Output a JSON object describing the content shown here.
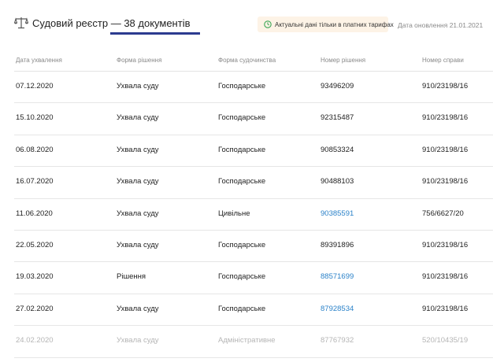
{
  "header": {
    "title": "Судовий реєстр — 38 документів",
    "notice": "Актуальні дані тільки в платних тарифах",
    "update_date": "Дата оновлення 21.01.2021"
  },
  "table": {
    "columns": [
      "Дата ухвалення",
      "Форма рішення",
      "Форма судочинства",
      "Номер рішення",
      "Номер справи"
    ],
    "rows": [
      {
        "date": "07.12.2020",
        "form": "Ухвала суду",
        "proceeding": "Господарське",
        "decision_no": "93496209",
        "case_no": "910/23198/16"
      },
      {
        "date": "15.10.2020",
        "form": "Ухвала суду",
        "proceeding": "Господарське",
        "decision_no": "92315487",
        "case_no": "910/23198/16"
      },
      {
        "date": "06.08.2020",
        "form": "Ухвала суду",
        "proceeding": "Господарське",
        "decision_no": "90853324",
        "case_no": "910/23198/16"
      },
      {
        "date": "16.07.2020",
        "form": "Ухвала суду",
        "proceeding": "Господарське",
        "decision_no": "90488103",
        "case_no": "910/23198/16"
      },
      {
        "date": "11.06.2020",
        "form": "Ухвала суду",
        "proceeding": "Цивільне",
        "decision_no": "90385591",
        "case_no": "756/6627/20",
        "link": true
      },
      {
        "date": "22.05.2020",
        "form": "Ухвала суду",
        "proceeding": "Господарське",
        "decision_no": "89391896",
        "case_no": "910/23198/16"
      },
      {
        "date": "19.03.2020",
        "form": "Рішення",
        "proceeding": "Господарське",
        "decision_no": "88571699",
        "case_no": "910/23198/16",
        "link": true
      },
      {
        "date": "27.02.2020",
        "form": "Ухвала суду",
        "proceeding": "Господарське",
        "decision_no": "87928534",
        "case_no": "910/23198/16",
        "link": true
      },
      {
        "date": "24.02.2020",
        "form": "Ухвала суду",
        "proceeding": "Адміністративне",
        "decision_no": "87767932",
        "case_no": "520/10435/19",
        "faded": true
      }
    ]
  },
  "colors": {
    "accent": "#2c3b8f",
    "link": "#2b82c9",
    "notice_bg": "#fdf3e6",
    "notice_icon": "#3aa655",
    "muted": "#8a8a8a"
  },
  "icons": {
    "title": "scale-icon",
    "notice": "clock-icon"
  }
}
